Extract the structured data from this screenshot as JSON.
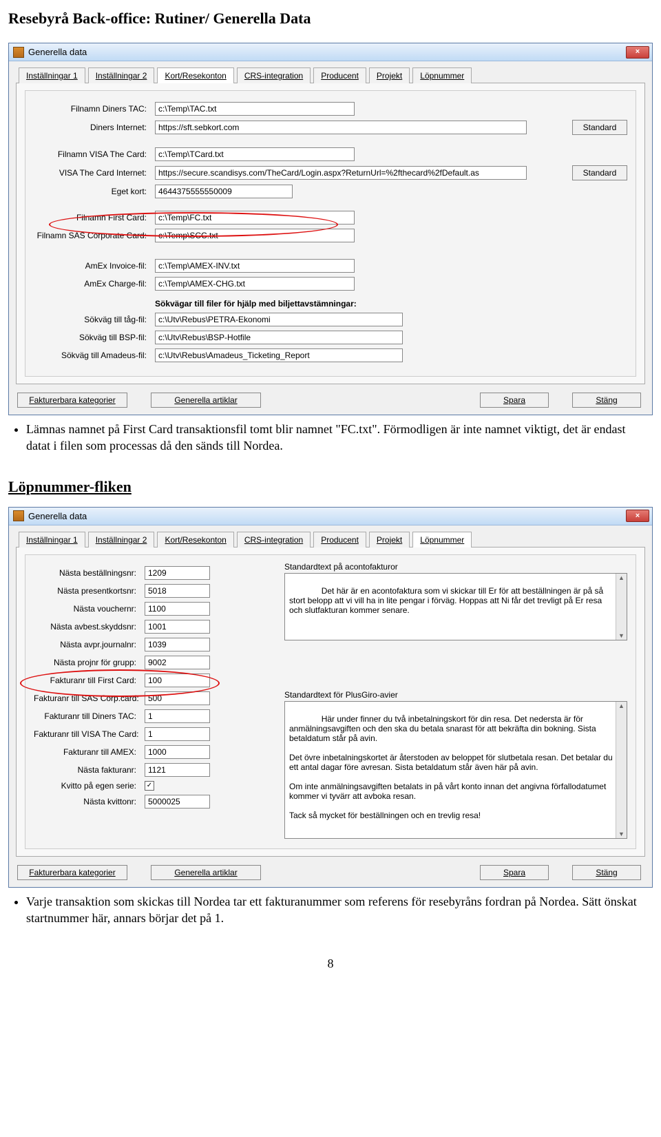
{
  "doc": {
    "title": "Resebyrå Back-office: Rutiner/ Generella Data",
    "section_lopnummer": "Löpnummer-fliken",
    "page_number": "8"
  },
  "bullets": {
    "b1": "Lämnas namnet på First Card transaktionsfil tomt blir namnet \"FC.txt\". Förmodligen är inte namnet viktigt, det är endast datat i filen som processas då den sänds till Nordea.",
    "b2": "Varje transaktion som skickas till Nordea tar ett fakturanummer som referens för resebyråns fordran på Nordea. Sätt önskat startnummer här, annars börjar det på 1."
  },
  "window": {
    "title": "Generella data",
    "close": "×",
    "tabs": [
      "Inställningar 1",
      "Inställningar 2",
      "Kort/Resekonton",
      "CRS-integration",
      "Producent",
      "Projekt",
      "Löpnummer"
    ],
    "bottom_buttons": {
      "kategorier": "Fakturerbara kategorier",
      "artiklar": "Generella artiklar",
      "spara": "Spara",
      "stang": "Stäng"
    }
  },
  "kort": {
    "fields": {
      "diners_tac_label": "Filnamn Diners TAC:",
      "diners_tac_value": "c:\\Temp\\TAC.txt",
      "diners_inet_label": "Diners Internet:",
      "diners_inet_value": "https://sft.sebkort.com",
      "visa_file_label": "Filnamn VISA The Card:",
      "visa_file_value": "c:\\Temp\\TCard.txt",
      "visa_inet_label": "VISA The Card Internet:",
      "visa_inet_value": "https://secure.scandisys.com/TheCard/Login.aspx?ReturnUrl=%2fthecard%2fDefault.as",
      "eget_kort_label": "Eget kort:",
      "eget_kort_value": "4644375555550009",
      "fc_file_label": "Filnamn First Card:",
      "fc_file_value": "c:\\Temp\\FC.txt",
      "sas_file_label": "Filnamn SAS Corporate Card:",
      "sas_file_value": "c:\\Temp\\SCC.txt",
      "amex_inv_label": "AmEx Invoice-fil:",
      "amex_inv_value": "c:\\Temp\\AMEX-INV.txt",
      "amex_chg_label": "AmEx Charge-fil:",
      "amex_chg_value": "c:\\Temp\\AMEX-CHG.txt",
      "sokvagar_label": "Sökvägar till filer för hjälp med biljettavstämningar:",
      "tag_label": "Sökväg till tåg-fil:",
      "tag_value": "c:\\Utv\\Rebus\\PETRA-Ekonomi",
      "bsp_label": "Sökväg till BSP-fil:",
      "bsp_value": "c:\\Utv\\Rebus\\BSP-Hotfile",
      "ama_label": "Sökväg till Amadeus-fil:",
      "ama_value": "c:\\Utv\\Rebus\\Amadeus_Ticketing_Report"
    },
    "standard_btn": "Standard"
  },
  "lop": {
    "left": {
      "bestallning_label": "Nästa beställningsnr:",
      "bestallning_value": "1209",
      "presentkort_label": "Nästa presentkortsnr:",
      "presentkort_value": "5018",
      "voucher_label": "Nästa vouchernr:",
      "voucher_value": "1100",
      "avbest_label": "Nästa avbest.skyddsnr:",
      "avbest_value": "1001",
      "avpr_label": "Nästa avpr.journalnr:",
      "avpr_value": "1039",
      "projnr_label": "Nästa projnr för grupp:",
      "projnr_value": "9002",
      "fnr_fc_label": "Fakturanr till First Card:",
      "fnr_fc_value": "100",
      "fnr_sas_label": "Fakturanr till SAS Corp.card:",
      "fnr_sas_value": "500",
      "fnr_diners_label": "Fakturanr till Diners TAC:",
      "fnr_diners_value": "1",
      "fnr_visa_label": "Fakturanr till VISA The Card:",
      "fnr_visa_value": "1",
      "fnr_amex_label": "Fakturanr till AMEX:",
      "fnr_amex_value": "1000",
      "nasta_fakt_label": "Nästa fakturanr:",
      "nasta_fakt_value": "1121",
      "kvitto_egen_label": "Kvitto på egen serie:",
      "kvitto_egen_check": "✓",
      "nasta_kvitto_label": "Nästa kvittonr:",
      "nasta_kvitto_value": "5000025"
    },
    "right": {
      "stdtxt_aconto_label": "Standardtext på acontofakturor",
      "stdtxt_aconto_value": "Det här är en acontofaktura som vi skickar till Er för att beställningen är på så stort belopp att vi vill ha in lite pengar i förväg. Hoppas att Ni får det trevligt på Er resa och slutfakturan kommer senare.",
      "stdtxt_plus_label": "Standardtext för PlusGiro-avier",
      "stdtxt_plus_value": "Här under finner du två inbetalningskort för din resa. Det nedersta är för anmälningsavgiften och den ska du betala snarast för att bekräfta din bokning. Sista betaldatum står på avin.\n\nDet övre inbetalningskortet är återstoden av beloppet för slutbetala resan. Det betalar du ett antal dagar före avresan. Sista betaldatum står även här på avin.\n\nOm inte anmälningsavgiften betalats in på vårt konto innan det angivna förfallodatumet kommer vi tyvärr att avboka resan.\n\nTack så mycket för beställningen och en trevlig resa!"
    }
  }
}
